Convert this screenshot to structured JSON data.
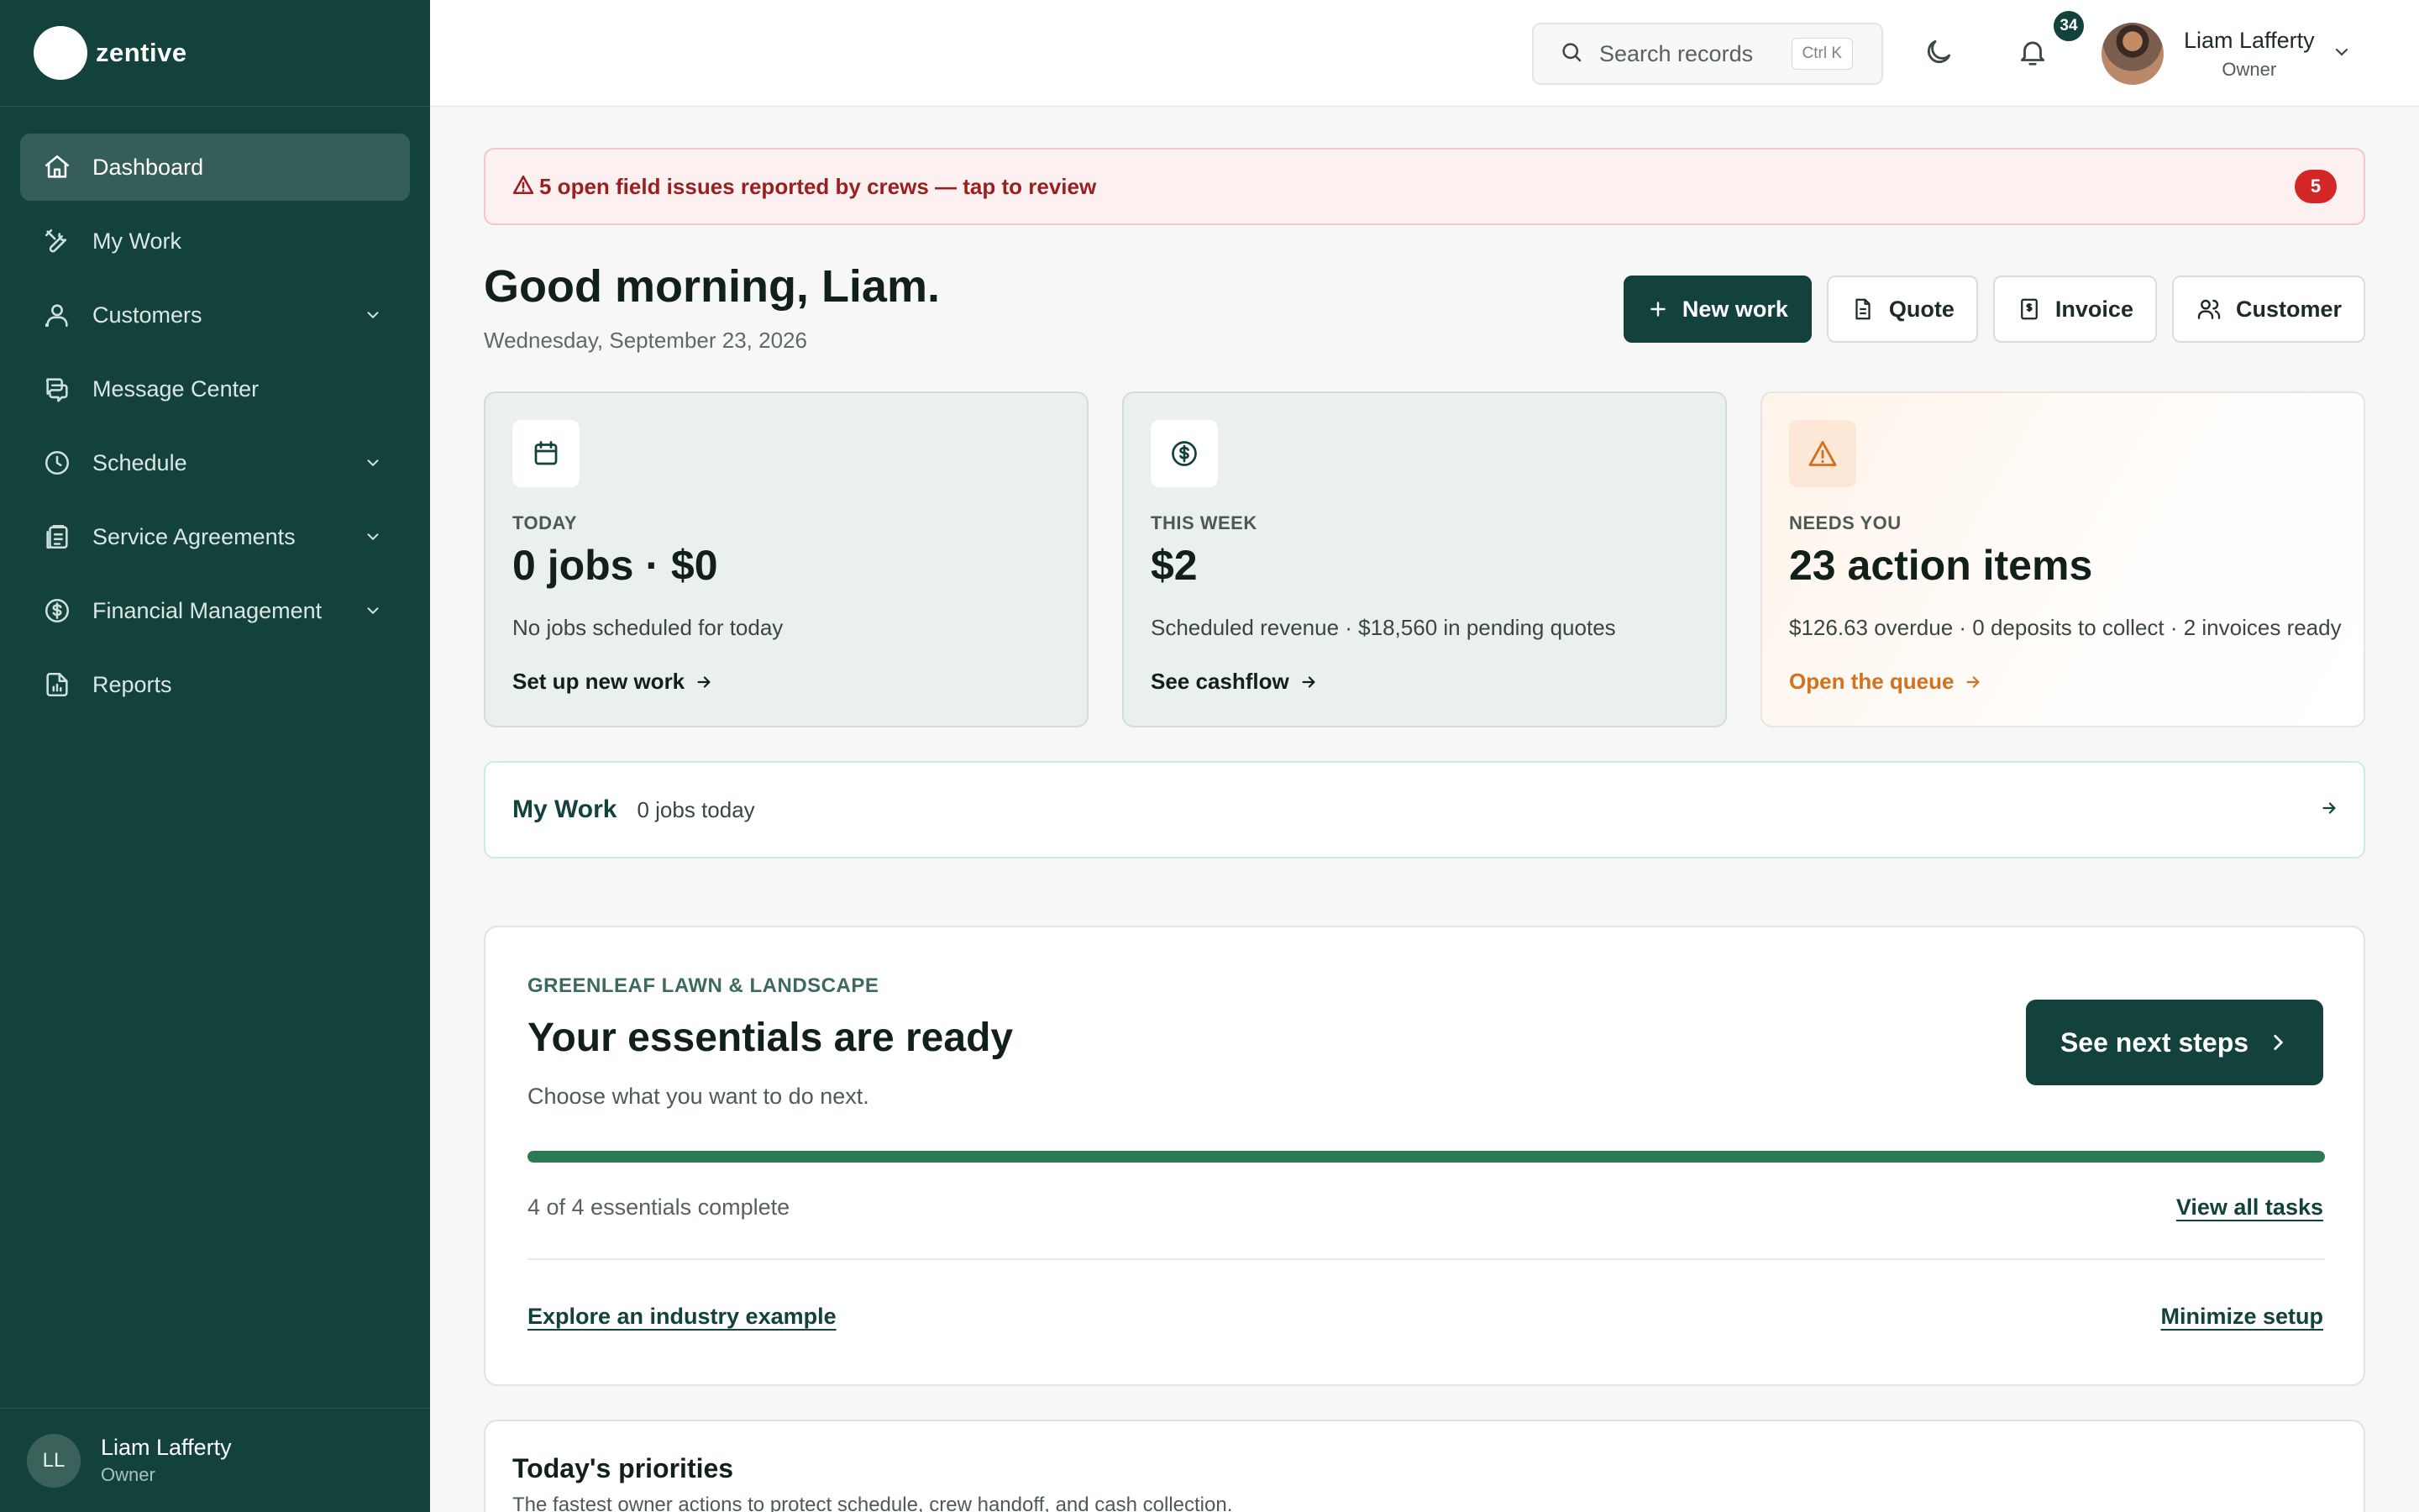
{
  "brand": {
    "name": "zentive"
  },
  "sidebar": {
    "items": [
      {
        "label": "Dashboard",
        "icon": "home-icon",
        "active": true,
        "expandable": false
      },
      {
        "label": "My Work",
        "icon": "tools-icon",
        "active": false,
        "expandable": false
      },
      {
        "label": "Customers",
        "icon": "users-icon",
        "active": false,
        "expandable": true
      },
      {
        "label": "Message Center",
        "icon": "chat-icon",
        "active": false,
        "expandable": false
      },
      {
        "label": "Schedule",
        "icon": "clock-icon",
        "active": false,
        "expandable": true
      },
      {
        "label": "Service Agreements",
        "icon": "clipboard-icon",
        "active": false,
        "expandable": true
      },
      {
        "label": "Financial Management",
        "icon": "dollar-icon",
        "active": false,
        "expandable": true
      },
      {
        "label": "Reports",
        "icon": "report-icon",
        "active": false,
        "expandable": false
      }
    ],
    "user": {
      "initials": "LL",
      "name": "Liam Lafferty",
      "role": "Owner"
    }
  },
  "topbar": {
    "search_placeholder": "Search records",
    "search_shortcut": "Ctrl K",
    "notification_count": "34",
    "user": {
      "name": "Liam Lafferty",
      "role": "Owner"
    }
  },
  "alert": {
    "text": "5 open field issues reported by crews — tap to review",
    "count": "5"
  },
  "greeting": {
    "title": "Good morning, Liam.",
    "date": "Wednesday, September 23, 2026"
  },
  "actions": {
    "new_work": "New work",
    "quote": "Quote",
    "invoice": "Invoice",
    "customer": "Customer"
  },
  "cards": [
    {
      "kicker": "TODAY",
      "value": "0 jobs · $0",
      "sub": "No jobs scheduled for today",
      "link": "Set up new work"
    },
    {
      "kicker": "THIS WEEK",
      "value": "$2",
      "sub": "Scheduled revenue · $18,560 in pending quotes",
      "link": "See cashflow"
    },
    {
      "kicker": "NEEDS YOU",
      "value": "23 action items",
      "sub": "$126.63 overdue · 0 deposits to collect · 2 invoices ready",
      "link": "Open the queue"
    }
  ],
  "my_work": {
    "title": "My Work",
    "sub": "0 jobs today"
  },
  "setup": {
    "kicker": "GREENLEAF LAWN & LANDSCAPE",
    "title": "Your essentials are ready",
    "sub": "Choose what you want to do next.",
    "button": "See next steps",
    "progress_fraction": 1.0,
    "progress_text": "4 of 4 essentials complete",
    "view_all": "View all tasks",
    "explore": "Explore an industry example",
    "minimize": "Minimize setup"
  },
  "priorities": {
    "title": "Today's priorities",
    "sub": "The fastest owner actions to protect schedule, crew handoff, and cash collection."
  },
  "colors": {
    "sidebar": "#12423b",
    "accent": "#12423b",
    "alert": "#9a1f1f",
    "warn_link": "#d3711d",
    "progress": "#2b7a55"
  }
}
